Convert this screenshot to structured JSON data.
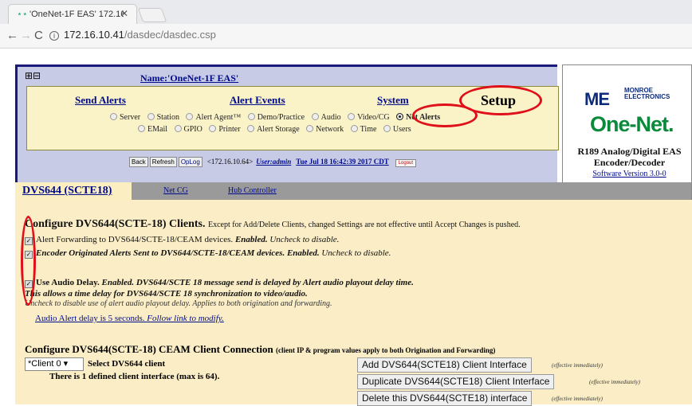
{
  "browser": {
    "tab_title": "'OneNet-1F EAS' 172.16.",
    "tab_close": "✕",
    "url_host": "172.16.10.41",
    "url_path": "/dasdec/dasdec.csp"
  },
  "header": {
    "name_title": "Name:'OneNet-1F EAS'",
    "nav": [
      "Send Alerts",
      "Alert Events",
      "System",
      "Setup"
    ],
    "radio_row1": [
      "Server",
      "Station",
      "Alert Agent™",
      "Demo/Practice",
      "Audio",
      "Video/CG",
      "Net Alerts"
    ],
    "radio_row2": [
      "EMail",
      "GPIO",
      "Printer",
      "Alert Storage",
      "Network",
      "Time",
      "Users"
    ],
    "selected_radio": "Net Alerts",
    "buttons": {
      "back": "Back",
      "refresh": "Refresh",
      "oplog": "OpLog",
      "ip": "<172.16.10.64>",
      "user": "User:admin",
      "date": "Tue Jul 18 16:42:39 2017 CDT",
      "logout": "Logout"
    }
  },
  "logo": {
    "monroe_mark": "ME",
    "monroe_text_1": "MONROE",
    "monroe_text_2": "ELECTRONICS",
    "onenet": "One-Net.",
    "model_line1": "R189 Analog/Digital EAS",
    "model_line2": "Encoder/Decoder",
    "version": "Software Version 3.0-0"
  },
  "tabs": [
    "DVS644 (SCTE18)",
    "Net CG",
    "Hub Controller"
  ],
  "config": {
    "heading": "Configure DVS644(SCTE-18) Clients.",
    "heading_note": "Except for Add/Delete Clients, changed Settings are not effective until Accept Changes is pushed.",
    "opt1_label": "Alert Forwarding to DVS644/SCTE-18/CEAM devices.",
    "opt1_status": "Enabled.",
    "opt1_hint": "Uncheck to disable.",
    "opt2_label": "Encoder Originated Alerts Sent to DVS644/SCTE-18/CEAM devices.",
    "opt2_status": "Enabled.",
    "opt2_hint": "Uncheck to disable.",
    "opt3_label": "Use Audio Delay.",
    "opt3_status": "Enabled. DVS644/SCTE 18 message send is delayed by Alert audio playout delay time.",
    "opt3_line2": "This allows a time delay for DVS644/SCTE 18 synchronization to video/audio.",
    "opt3_line3": "Uncheck to disable use of alert audio playout delay. Applies to both origination and forwarding.",
    "audio_link_prefix": "Audio Alert delay is 5 seconds.",
    "audio_link_follow": "Follow link to modify."
  },
  "ceam": {
    "heading": "Configure DVS644(SCTE-18) CEAM Client Connection",
    "heading_note": "(client IP & program values apply to both Origination and Forwarding)",
    "select_value": "*Client 0 ▾",
    "select_label": "Select DVS644 client",
    "defined": "There is 1 defined client interface (max is 64).",
    "btn_add": "Add DVS644(SCTE18) Client Interface",
    "btn_duplicate": "Duplicate DVS644(SCTE18) Client Interface",
    "btn_delete": "Delete this DVS644(SCTE18) interface",
    "effective": "(effective immediately)"
  },
  "colors": {
    "annotation": "#e0101a",
    "link": "#000b8a",
    "panel": "#c7cbe6",
    "content": "#fbeec6"
  }
}
